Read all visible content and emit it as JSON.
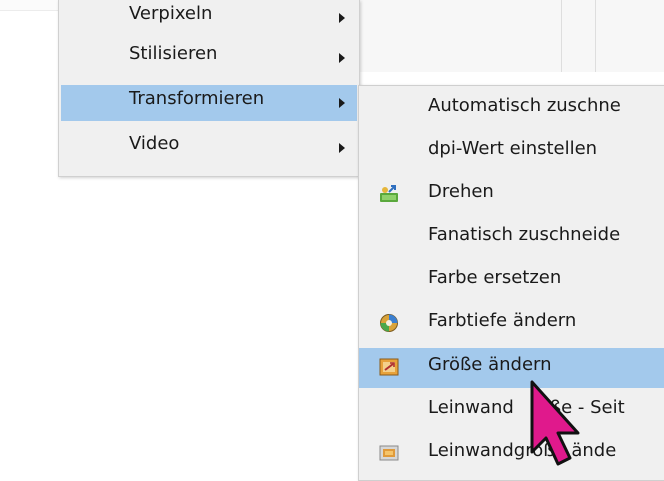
{
  "parent_menu": {
    "items": [
      {
        "label": "Verpixeln"
      },
      {
        "label": "Stilisieren"
      },
      {
        "label": "Transformieren"
      },
      {
        "label": "Video"
      }
    ]
  },
  "submenu": {
    "items": [
      {
        "label": "Automatisch zuschne",
        "icon": ""
      },
      {
        "label": "dpi-Wert einstellen",
        "icon": ""
      },
      {
        "label": "Drehen",
        "icon": "rotate-icon"
      },
      {
        "label": "Fanatisch zuschneide",
        "icon": ""
      },
      {
        "label": "Farbe ersetzen",
        "icon": ""
      },
      {
        "label": "Farbtiefe ändern",
        "icon": "color-depth-icon"
      },
      {
        "label": "Größe ändern",
        "icon": "resize-icon"
      },
      {
        "label": "Leinwand",
        "label2": "ße - Seit",
        "icon": ""
      },
      {
        "label": "Leinwandgröße ände",
        "icon": "canvas-size-icon"
      }
    ]
  },
  "colors": {
    "menu_bg": "#f0f0f0",
    "highlight": "#a3c9ec",
    "cursor": "#e0198c"
  }
}
